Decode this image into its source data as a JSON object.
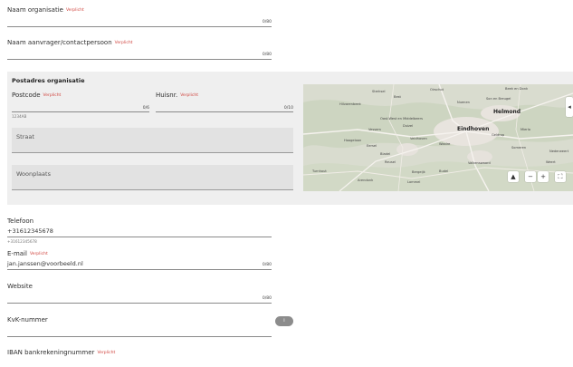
{
  "org_name": {
    "label": "Naam organisatie",
    "required": "Verplicht",
    "counter": "0/80"
  },
  "applicant": {
    "label": "Naam aanvrager/contactpersoon",
    "required": "Verplicht",
    "counter": "0/80"
  },
  "postal": {
    "title": "Postadres organisatie",
    "postcode": {
      "label": "Postcode",
      "required": "Verplicht",
      "counter": "0/6",
      "hint": "1234AB"
    },
    "house_number": {
      "label": "Huisnr.",
      "required": "Verplicht",
      "counter": "0/10"
    },
    "street": {
      "label": "Straat"
    },
    "city": {
      "label": "Woonplaats"
    }
  },
  "map": {
    "places": [
      "Sterksel",
      "Nuenen",
      "Helmond",
      "Eindhoven",
      "Veldhoven",
      "Geldrop",
      "Waalre",
      "Valkenswaard",
      "Best",
      "Oirschot",
      "Son en Breugel",
      "Beek en Donk",
      "Mierlo",
      "Someren",
      "Bladel",
      "Reusel",
      "Arendonk",
      "Turnhout",
      "Lommel",
      "Nederweert",
      "Weert",
      "Budel",
      "Bergeijk",
      "Hilvarenbeek",
      "Oost-West en Middelbeers",
      "Vessem",
      "Hoogeloon",
      "Eersel",
      "Duizel"
    ],
    "cities": [
      "Eindhoven",
      "Helmond"
    ],
    "controls": {
      "north": "▲",
      "zoom_out": "−",
      "zoom_in": "+",
      "fullscreen": "⛶",
      "collapse": "◂"
    }
  },
  "phone": {
    "label": "Telefoon",
    "value": "+31612345678",
    "hint": "+31612345678"
  },
  "email": {
    "label": "E-mail",
    "required": "Verplicht",
    "value": "jan.janssen@voorbeeld.nl",
    "counter": "0/80"
  },
  "website": {
    "label": "Website",
    "counter": "0/80"
  },
  "kvk": {
    "label": "KvK-nummer",
    "info_icon": "info-icon",
    "info_glyph": "i"
  },
  "iban": {
    "label": "IBAN bankrekeningnummer",
    "required": "Verplicht"
  },
  "colors": {
    "required": "#d0453f",
    "panel": "#efefef",
    "field": "#e2e2e2"
  }
}
